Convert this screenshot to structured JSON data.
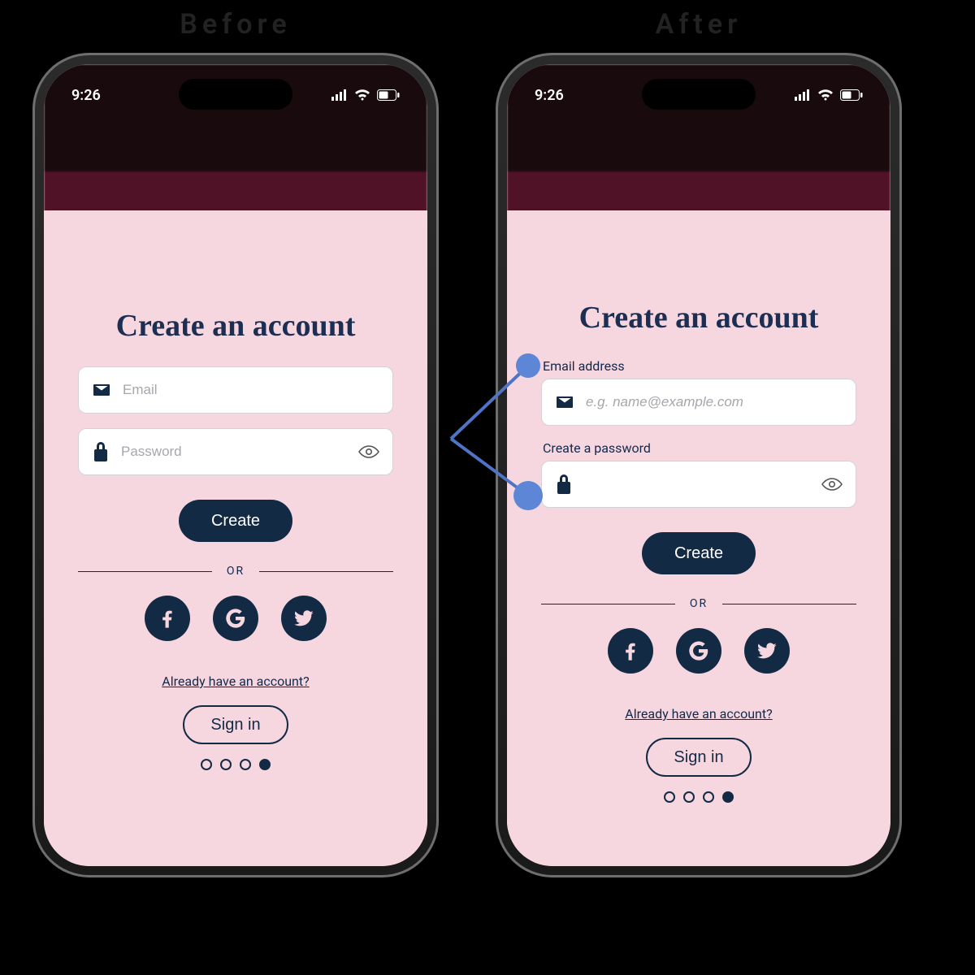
{
  "captions": {
    "before": "Before",
    "after": "After"
  },
  "status": {
    "time": "9:26"
  },
  "colors": {
    "navy": "#132a45",
    "blush": "#f7d7df",
    "annotation": "#4f74c4"
  },
  "before": {
    "title": "Create an account",
    "email_placeholder": "Email",
    "password_placeholder": "Password",
    "create_label": "Create",
    "or_label": "OR",
    "already_link": "Already have an account?",
    "signin_label": "Sign in"
  },
  "after": {
    "title": "Create an account",
    "email_label": "Email address",
    "email_placeholder": "e.g. name@example.com",
    "password_label": "Create a password",
    "create_label": "Create",
    "or_label": "OR",
    "already_link": "Already have an account?",
    "signin_label": "Sign in"
  },
  "pager": {
    "count": 4,
    "active_index": 3
  }
}
